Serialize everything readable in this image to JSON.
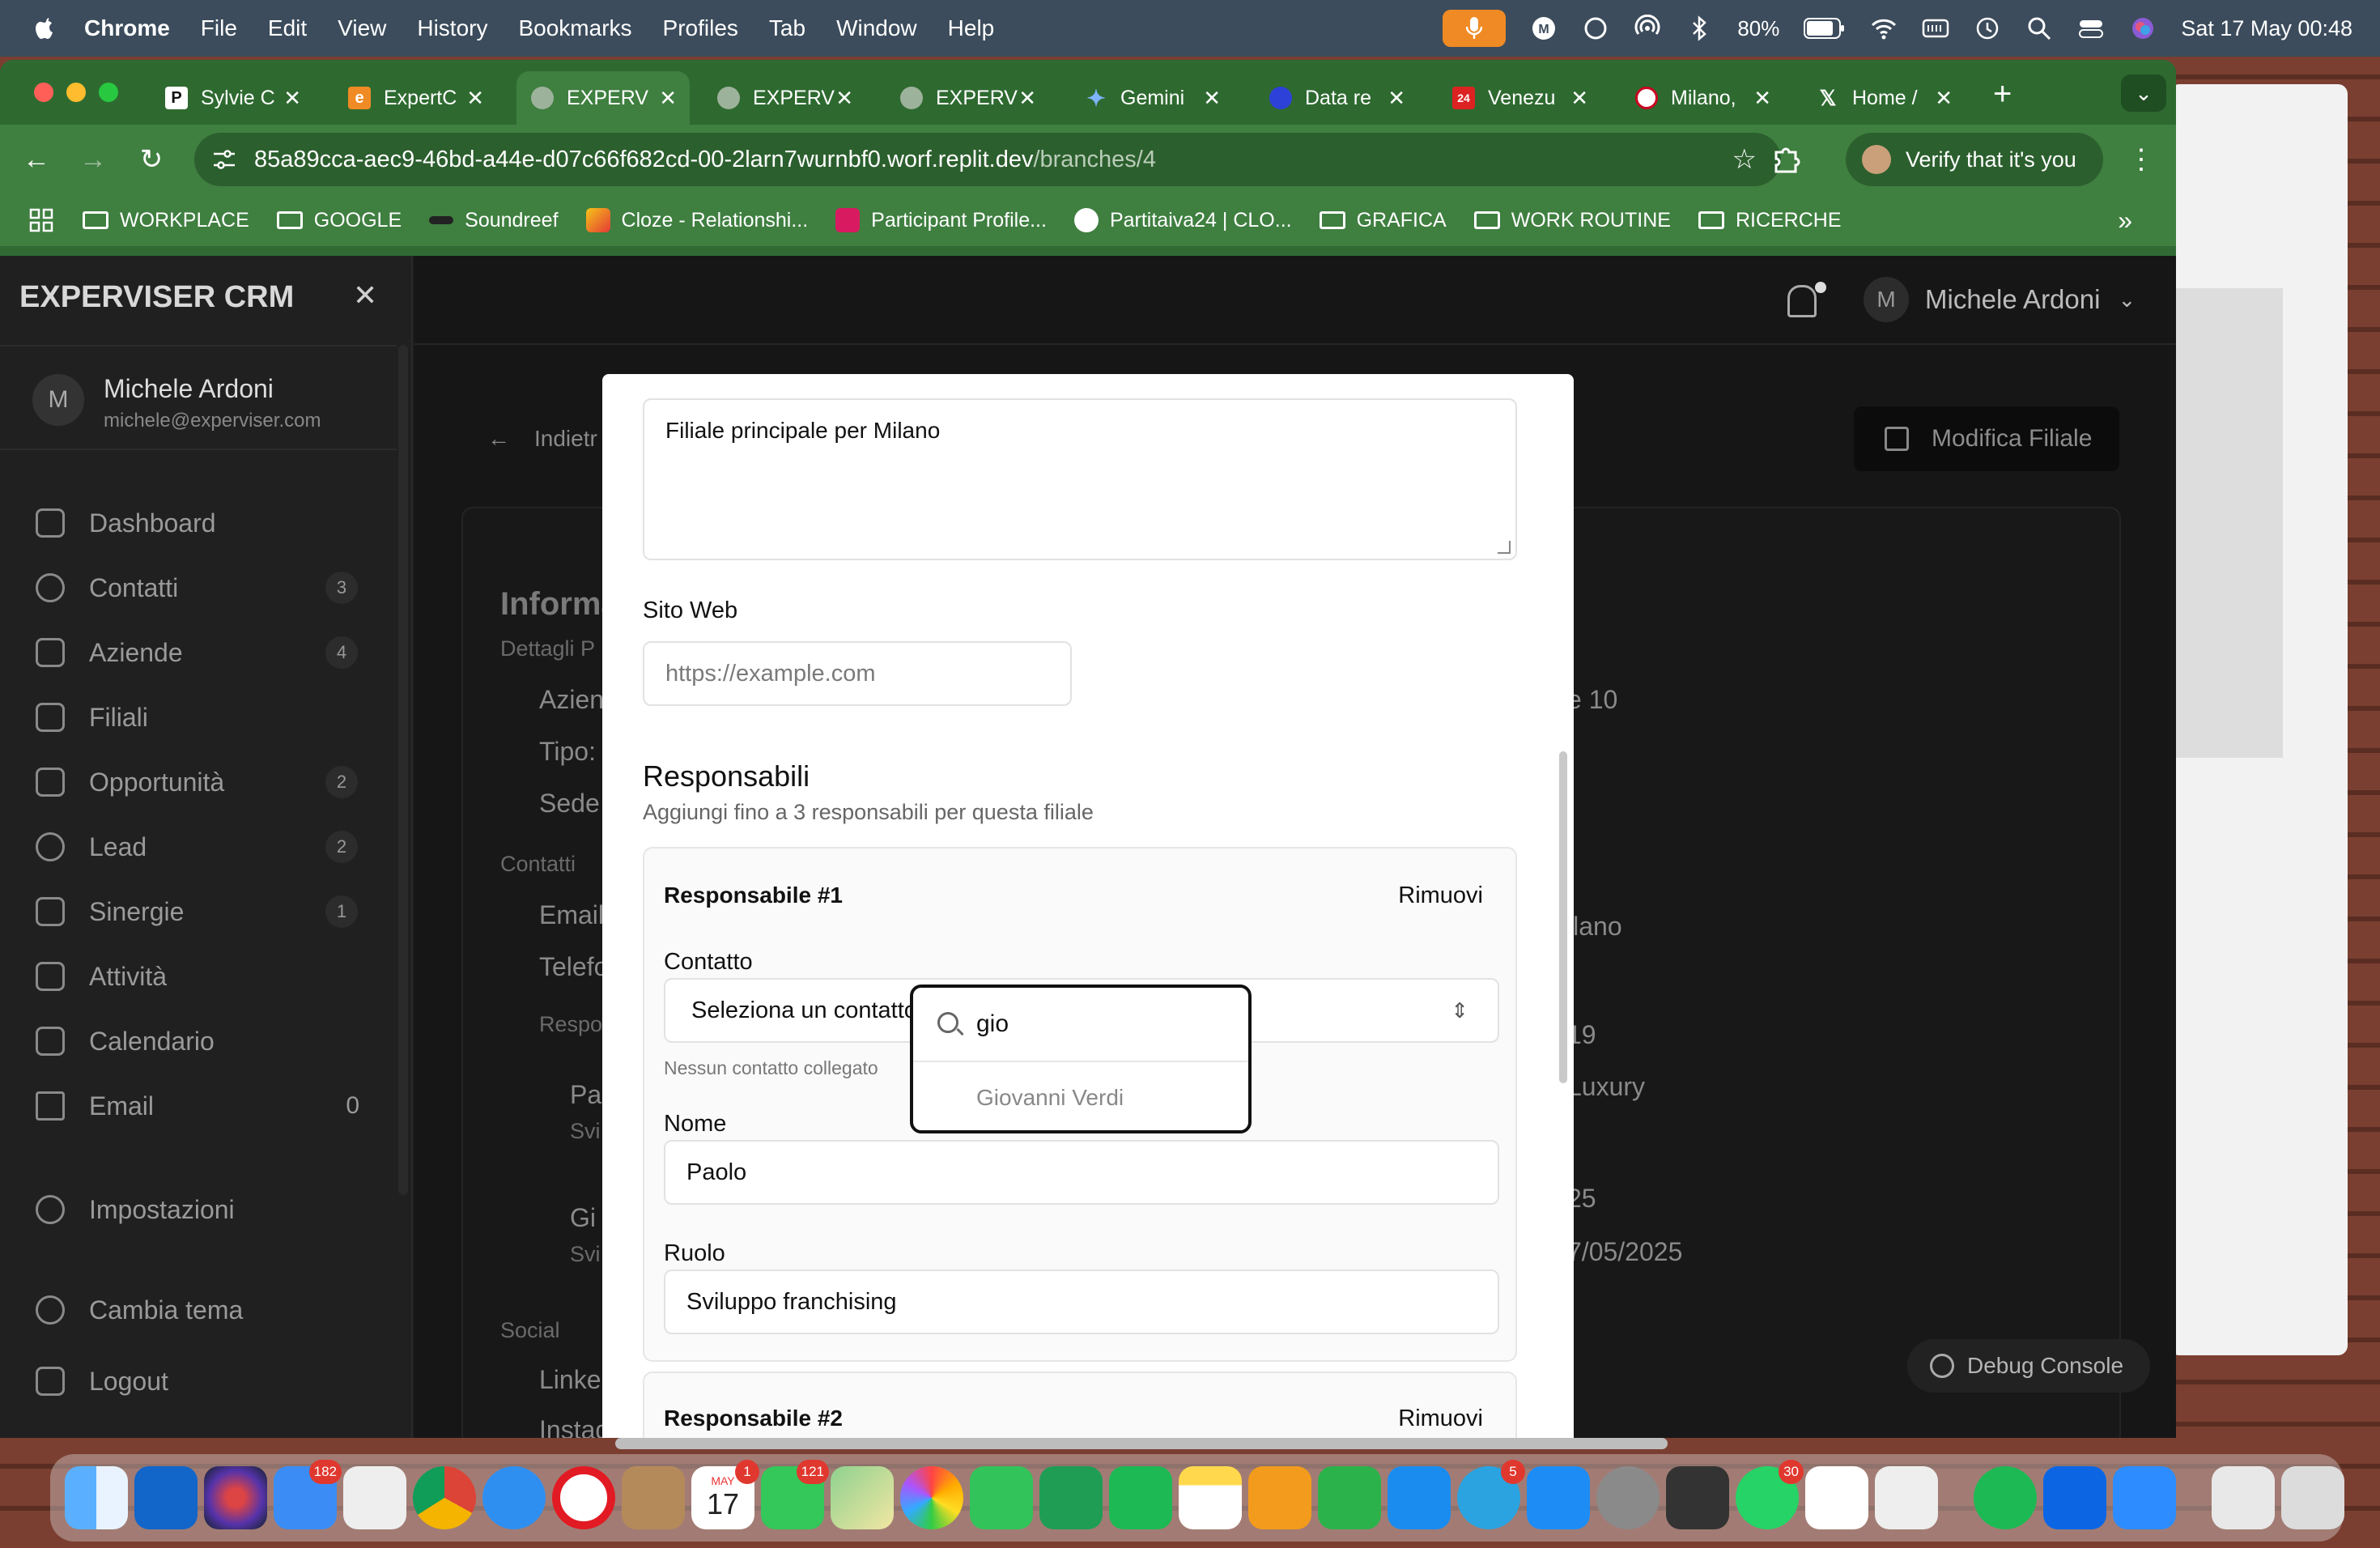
{
  "menubar": {
    "app": "Chrome",
    "items": [
      "File",
      "Edit",
      "View",
      "History",
      "Bookmarks",
      "Profiles",
      "Tab",
      "Window",
      "Help"
    ],
    "battery": "80%",
    "datetime": "Sat 17 May  00:48"
  },
  "browser": {
    "tabs": [
      {
        "label": "Sylvie C",
        "icon": "P"
      },
      {
        "label": "ExpertC",
        "icon": "e"
      },
      {
        "label": "EXPERV",
        "icon": "replit"
      },
      {
        "label": "EXPERV",
        "icon": "replit"
      },
      {
        "label": "EXPERV",
        "icon": "replit"
      },
      {
        "label": "Gemini",
        "icon": "gemini"
      },
      {
        "label": "Data re",
        "icon": "data"
      },
      {
        "label": "Venezu",
        "icon": "24"
      },
      {
        "label": "Milano,",
        "icon": "milan"
      },
      {
        "label": "Home /",
        "icon": "X"
      }
    ],
    "url_host": "85a89cca-aec9-46bd-a44e-d07c66f682cd-00-2larn7wurnbf0.worf.replit.dev",
    "url_path": "/branches/4",
    "verify": "Verify that it's you",
    "bookmarks": [
      {
        "label": "WORKPLACE",
        "type": "folder"
      },
      {
        "label": "GOOGLE",
        "type": "folder"
      },
      {
        "label": "Soundreef",
        "type": "site"
      },
      {
        "label": "Cloze - Relationshi...",
        "type": "site"
      },
      {
        "label": "Participant Profile...",
        "type": "site"
      },
      {
        "label": "Partitaiva24 | CLO...",
        "type": "site"
      },
      {
        "label": "GRAFICA",
        "type": "folder"
      },
      {
        "label": "WORK ROUTINE",
        "type": "folder"
      },
      {
        "label": "RICERCHE",
        "type": "folder"
      }
    ]
  },
  "sidebar": {
    "title": "EXPERVISER CRM",
    "user_name": "Michele Ardoni",
    "user_initial": "M",
    "user_email": "michele@experviser.com",
    "items": [
      {
        "label": "Dashboard",
        "badge": ""
      },
      {
        "label": "Contatti",
        "badge": "3"
      },
      {
        "label": "Aziende",
        "badge": "4"
      },
      {
        "label": "Filiali",
        "badge": ""
      },
      {
        "label": "Opportunità",
        "badge": "2"
      },
      {
        "label": "Lead",
        "badge": "2"
      },
      {
        "label": "Sinergie",
        "badge": "1"
      },
      {
        "label": "Attività",
        "badge": ""
      },
      {
        "label": "Calendario",
        "badge": ""
      },
      {
        "label": "Email",
        "count": "0"
      }
    ],
    "settings": "Impostazioni",
    "theme": "Cambia tema",
    "logout": "Logout"
  },
  "header": {
    "user_name": "Michele Ardoni",
    "user_initial": "M",
    "back": "Indietr",
    "edit": "Modifica Filiale"
  },
  "background_page": {
    "heading": "Informa",
    "dettagli": "Dettagli P",
    "azienda": "Azien",
    "tipo": "Tipo:",
    "sede": "Sede",
    "contatti": "Contatti",
    "email": "Email",
    "telefono": "Telefo",
    "resp": "Respo",
    "pa": "Pa",
    "pa_sub": "Svi",
    "gi": "Gi",
    "gi_sub": "Svi",
    "social": "Social",
    "linkedin": "Linke",
    "instagram": "Instag",
    "right_1": "e 10",
    "right_2": "ilano",
    "right_3": "19",
    "right_4": "Luxury",
    "right_5": "25",
    "right_6": "7/05/2025",
    "debug": "Debug Console"
  },
  "modal": {
    "description_value": "Filiale principale per Milano",
    "website_label": "Sito Web",
    "website_placeholder": "https://example.com",
    "section_title": "Responsabili",
    "section_subtitle": "Aggiungi fino a 3 responsabili per questa filiale",
    "resp1": {
      "title": "Responsabile #1",
      "remove": "Rimuovi",
      "contact_label": "Contatto",
      "contact_value": "Seleziona un contatto...",
      "hint": "Nessun contatto collegato",
      "name_label": "Nome",
      "name_value": "Paolo",
      "role_label": "Ruolo",
      "role_value": "Sviluppo franchising"
    },
    "resp2": {
      "title": "Responsabile #2",
      "remove": "Rimuovi"
    }
  },
  "dropdown": {
    "query": "gio",
    "option": "Giovanni Verdi"
  },
  "dock": {
    "badges": {
      "mail": "182",
      "calendar_month": "MAY",
      "calendar_day": "17",
      "calendar_badge": "1",
      "messages": "121",
      "telegram": "5",
      "whatsapp": "30"
    }
  }
}
